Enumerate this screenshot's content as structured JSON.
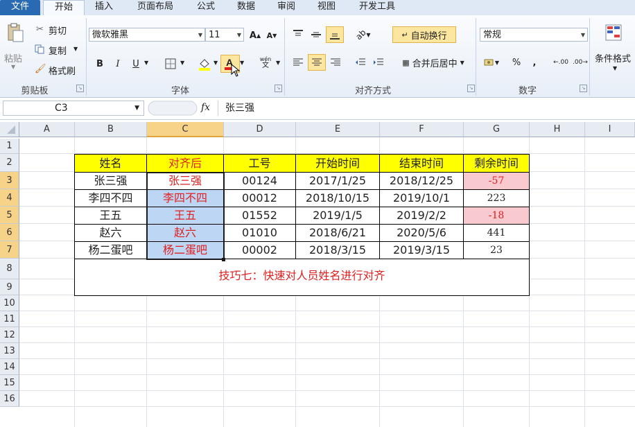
{
  "tabs": [
    "文件",
    "开始",
    "插入",
    "页面布局",
    "公式",
    "数据",
    "审阅",
    "视图",
    "开发工具"
  ],
  "clipboard": {
    "paste": "粘贴",
    "cut": "剪切",
    "copy": "复制",
    "format_painter": "格式刷",
    "group": "剪贴板"
  },
  "font": {
    "name": "微软雅黑",
    "size": "11",
    "group": "字体",
    "bold": "B",
    "italic": "I",
    "underline": "U"
  },
  "alignment": {
    "wrap_text": "自动换行",
    "merge_center": "合并后居中",
    "group": "对齐方式"
  },
  "number": {
    "format": "常规",
    "group": "数字",
    "percent": "%",
    "comma": ","
  },
  "styles": {
    "conditional": "条件格式"
  },
  "formula_bar": {
    "name_box": "C3",
    "fx": "fx",
    "content": "张三强"
  },
  "columns": [
    "A",
    "B",
    "C",
    "D",
    "E",
    "F",
    "G",
    "H",
    "I"
  ],
  "rows": [
    "1",
    "2",
    "3",
    "4",
    "5",
    "6",
    "7",
    "8",
    "9",
    "10",
    "11",
    "12",
    "13",
    "14",
    "15",
    "16"
  ],
  "table": {
    "headers": [
      "姓名",
      "对齐后",
      "工号",
      "开始时间",
      "结束时间",
      "剩余时间"
    ],
    "rows": [
      [
        "张三强",
        "张三强",
        "00124",
        "2017/1/25",
        "2018/12/25",
        "-57"
      ],
      [
        "李四不四",
        "李四不四",
        "00012",
        "2018/10/15",
        "2019/10/1",
        "223"
      ],
      [
        "王五",
        "王五",
        "01552",
        "2019/1/5",
        "2019/2/2",
        "-18"
      ],
      [
        "赵六",
        "赵六",
        "01010",
        "2018/6/21",
        "2020/5/6",
        "441"
      ],
      [
        "杨二蛋吧",
        "杨二蛋吧",
        "00002",
        "2018/3/15",
        "2019/3/15",
        "23"
      ]
    ],
    "note": "技巧七：快速对人员姓名进行对齐"
  },
  "colors": {
    "header_fill": "#ffff00",
    "accent_red": "#e02020",
    "selection": "#bcd6f4",
    "negative_fill": "#f8c9cf"
  }
}
